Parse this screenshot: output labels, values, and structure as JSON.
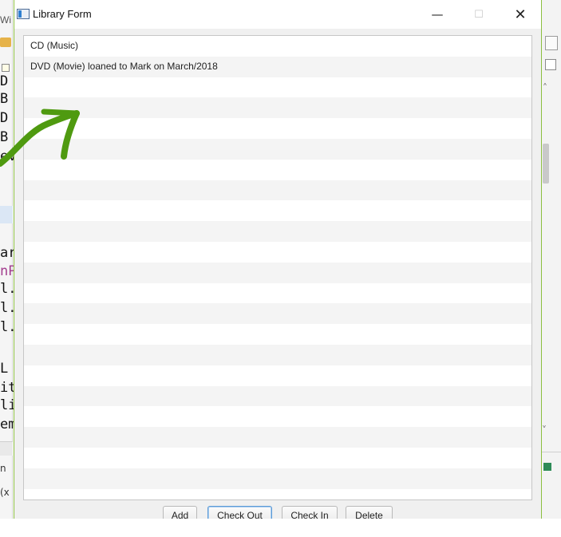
{
  "background_ide": {
    "window_title_fragment": "Wi",
    "code_lines": [
      {
        "text": "D",
        "color": "#111111"
      },
      {
        "text": "B",
        "color": "#111111"
      },
      {
        "text": "D",
        "color": "#111111"
      },
      {
        "text": "B",
        "color": "#111111"
      },
      {
        "text": "ev",
        "color": "#111111"
      },
      {
        "text": "ar",
        "color": "#111111"
      },
      {
        "text": "nP",
        "color": "#a33e8e"
      },
      {
        "text": "l.",
        "color": "#111111"
      },
      {
        "text": "l.",
        "color": "#111111"
      },
      {
        "text": "l.",
        "color": "#111111"
      },
      {
        "text": "L",
        "color": "#111111"
      },
      {
        "text": "it",
        "color": "#111111"
      },
      {
        "text": "li",
        "color": "#111111"
      },
      {
        "text": "em",
        "color": "#111111"
      }
    ],
    "bottom_text_1": "n",
    "bottom_text_2": "(x"
  },
  "annotation": {
    "arrow_color": "#4f9a10"
  },
  "dialog": {
    "title": "Library Form",
    "controls": {
      "minimize": "—",
      "maximize": "☐",
      "close": "✕"
    },
    "list": {
      "items": [
        "CD (Music)",
        "DVD (Movie) loaned to Mark on March/2018"
      ]
    },
    "buttons": {
      "add": "Add",
      "check_out": "Check Out",
      "check_in": "Check In",
      "delete": "Delete"
    }
  }
}
